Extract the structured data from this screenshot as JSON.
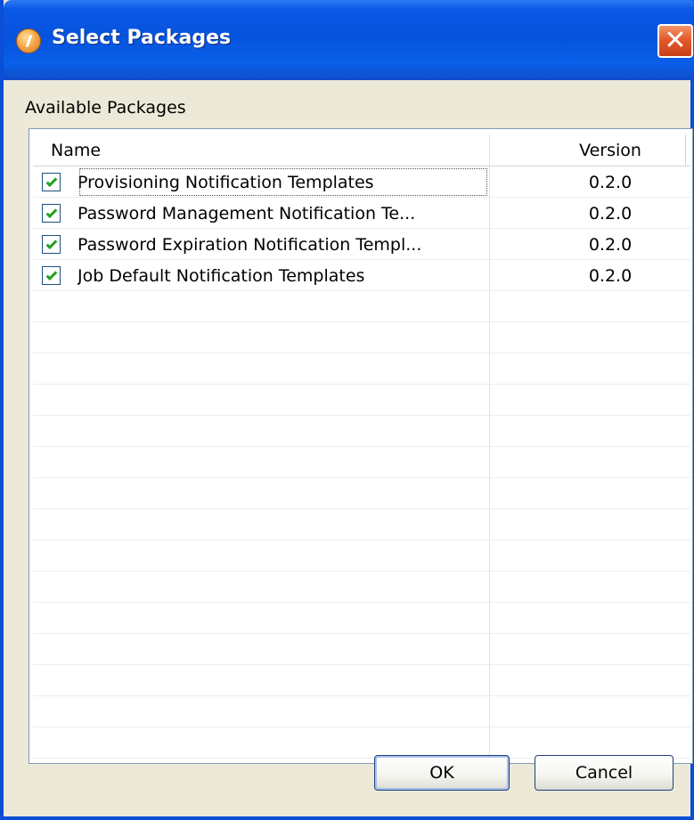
{
  "window": {
    "title": "Select Packages",
    "close_icon": "close-icon",
    "app_icon": "app-icon"
  },
  "section_label": "Available Packages",
  "table": {
    "columns": [
      "Name",
      "Version"
    ],
    "rows": [
      {
        "checked": true,
        "name": "Provisioning Notification Templates",
        "version": "0.2.0"
      },
      {
        "checked": true,
        "name": "Password Management Notification Te...",
        "version": "0.2.0"
      },
      {
        "checked": true,
        "name": "Password Expiration Notification Templ...",
        "version": "0.2.0"
      },
      {
        "checked": true,
        "name": "Job Default Notification Templates",
        "version": "0.2.0"
      }
    ]
  },
  "buttons": {
    "ok": "OK",
    "cancel": "Cancel"
  },
  "colors": {
    "titlebar": "#0553DD",
    "close": "#E55A2B",
    "background": "#ECE9D8",
    "check": "#21A121"
  }
}
